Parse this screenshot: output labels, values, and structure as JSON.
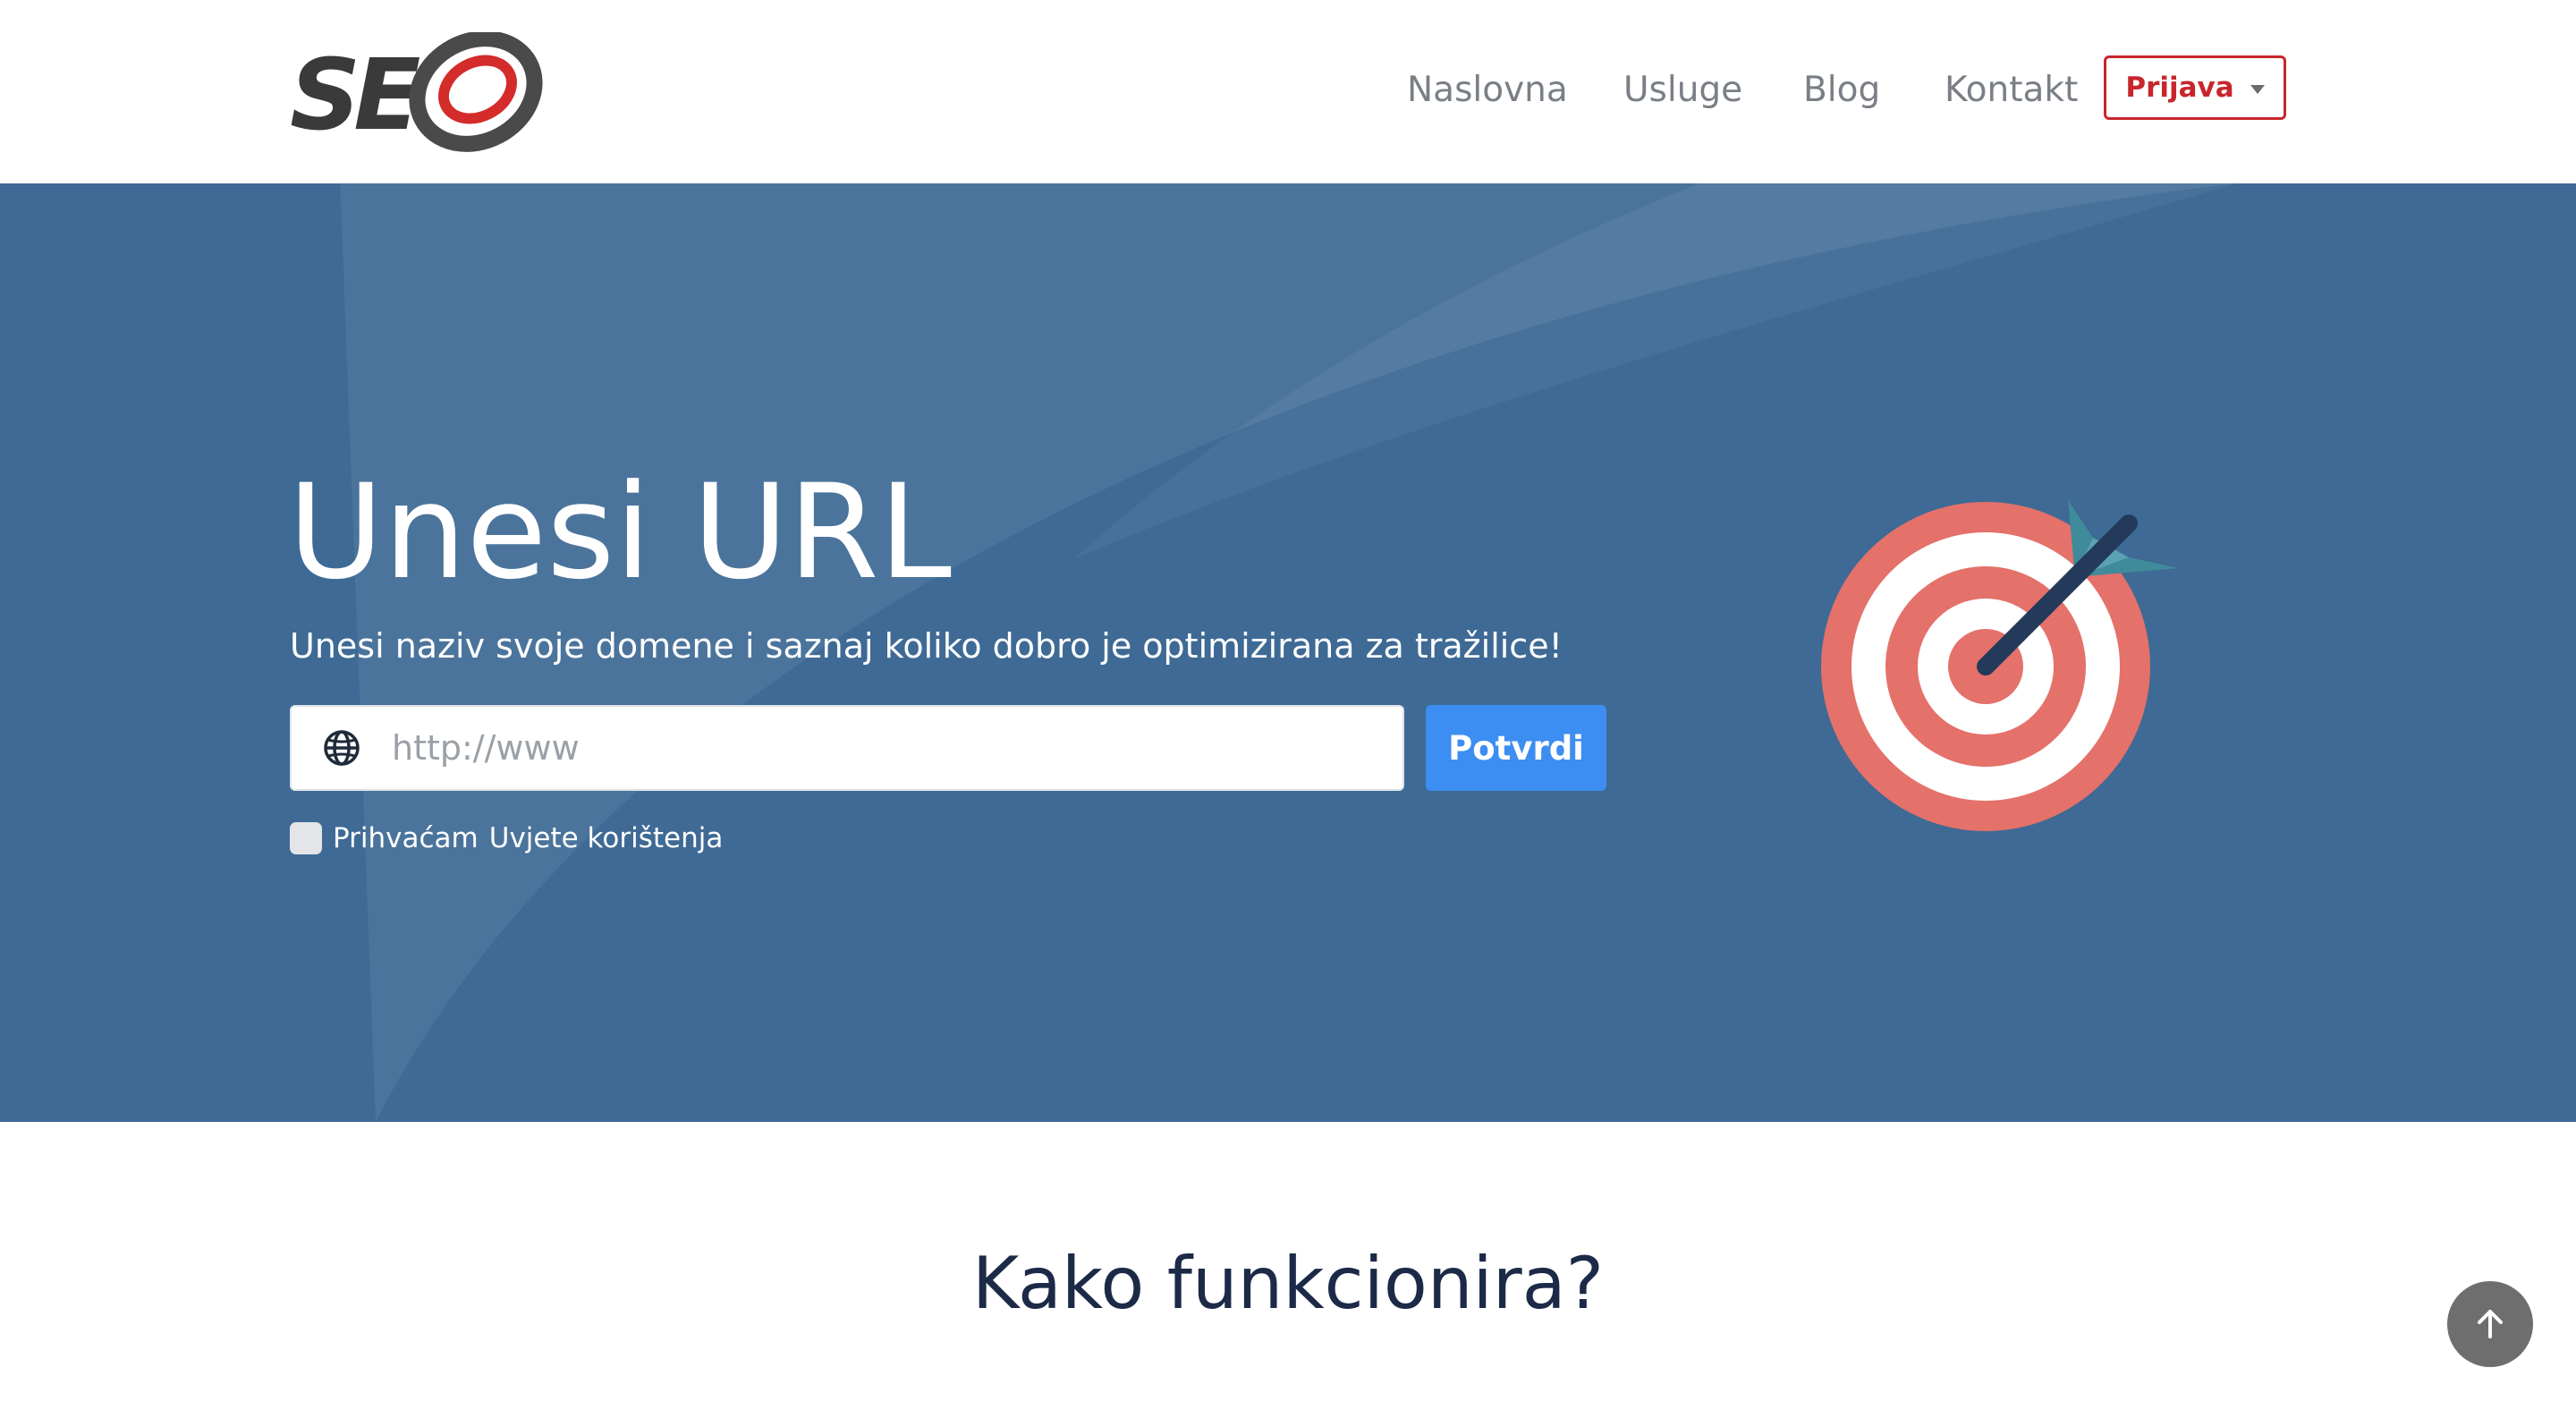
{
  "header": {
    "logo_alt": "SEO",
    "nav": [
      {
        "label": "Naslovna"
      },
      {
        "label": "Usluge"
      },
      {
        "label": "Blog"
      },
      {
        "label": "Kontakt"
      }
    ],
    "login_label": "Prijava"
  },
  "hero": {
    "title": "Unesi URL",
    "subtitle": "Unesi naziv svoje domene i saznaj koliko dobro je optimizirana za tražilice!",
    "input_placeholder": "http://www",
    "input_value": "",
    "submit_label": "Potvrdi",
    "terms_prefix": "Prihvaćam",
    "terms_link": "Uvjete korištenja",
    "terms_checked": false
  },
  "section": {
    "title": "Kako funkcionira?"
  },
  "colors": {
    "hero_bg": "#3e6a95",
    "accent_red": "#c8262c",
    "button_blue": "#3d8ef2",
    "heading_dark": "#1c2a48",
    "target_red": "#e4716a",
    "arrow_teal": "#3f8a9b"
  },
  "icons": {
    "logo": "seo-logo",
    "input": "globe-icon",
    "illustration": "target-icon",
    "scroll": "arrow-up-icon",
    "dropdown": "caret-down-icon"
  }
}
